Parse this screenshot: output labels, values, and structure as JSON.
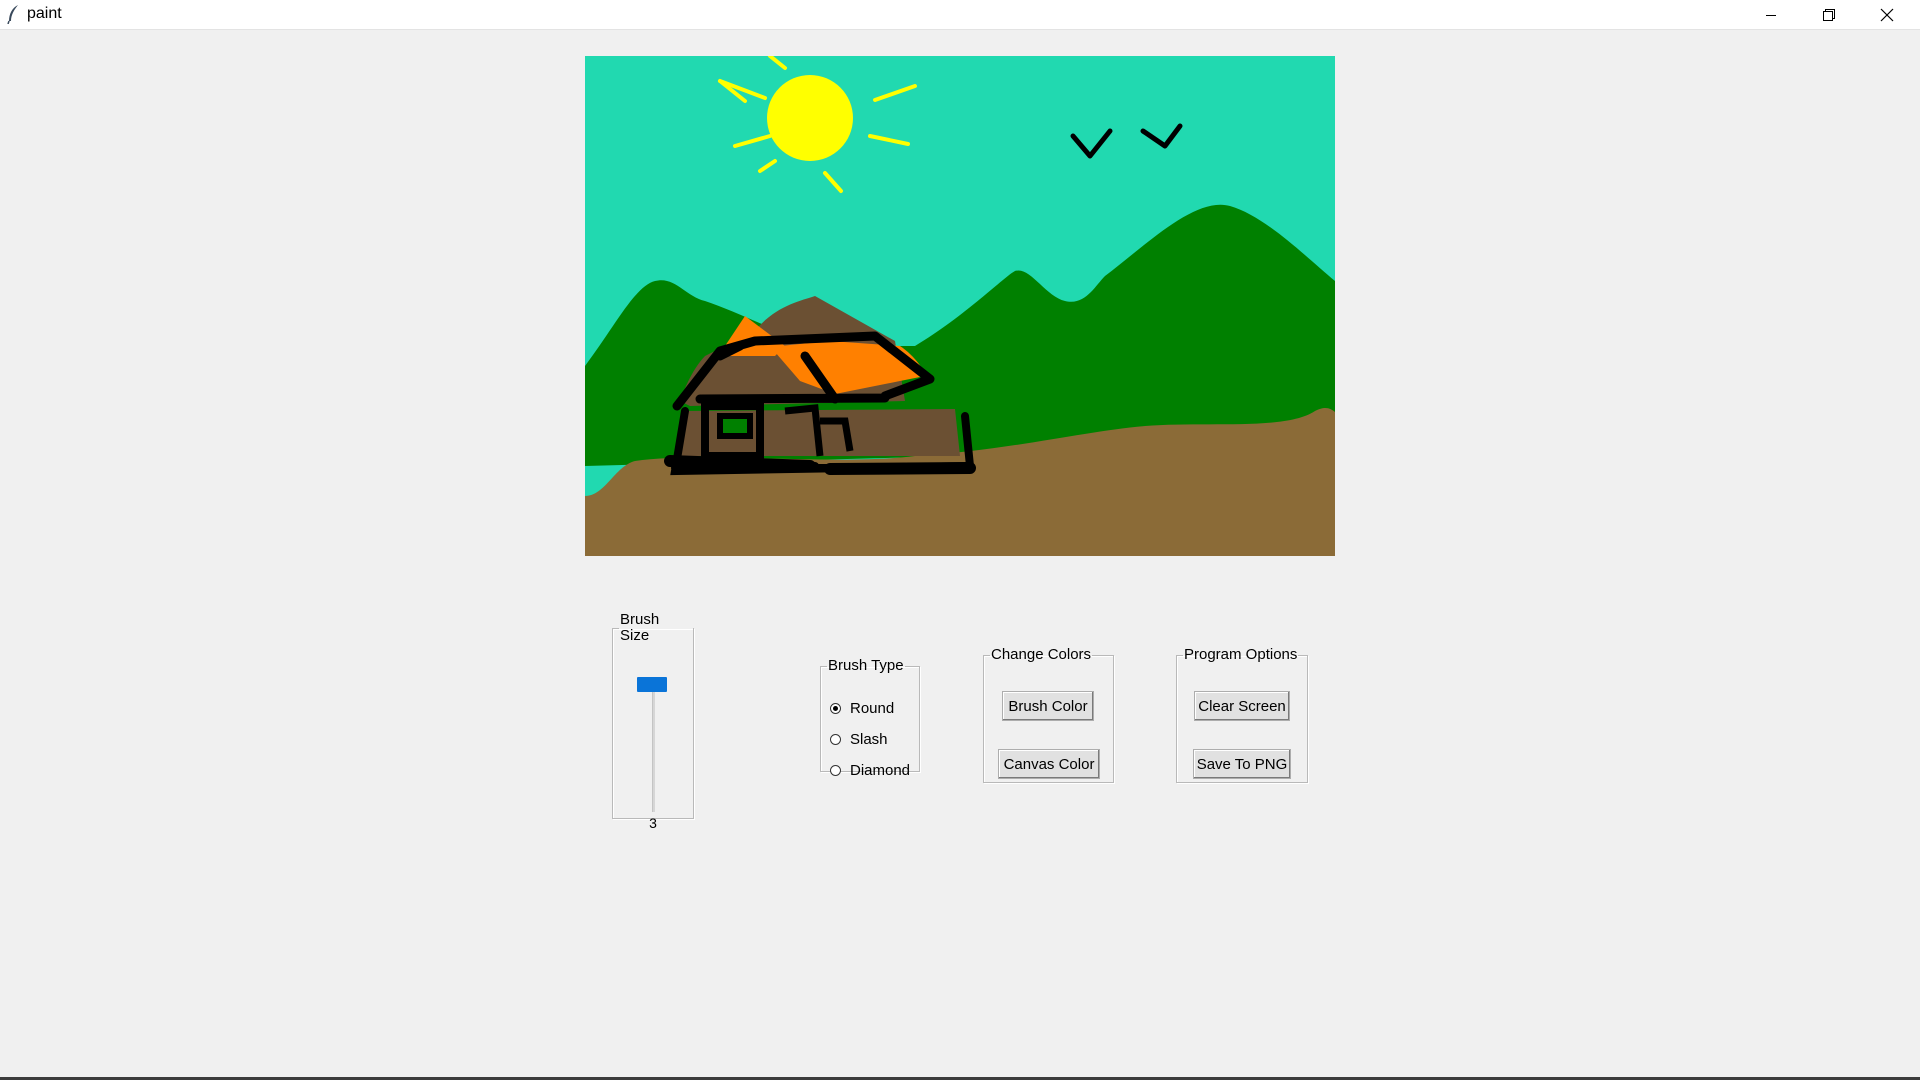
{
  "window": {
    "title": "paint",
    "icon": "feather-icon",
    "controls": [
      "minimize-icon",
      "restore-icon",
      "close-icon"
    ]
  },
  "canvas": {
    "background_color": "#21d9b0",
    "drawing": [
      "sun",
      "two birds",
      "green mountains",
      "brown ground",
      "house with orange roof"
    ]
  },
  "brush_size": {
    "legend": "Brush Size",
    "value": "3",
    "slider_color": "#0a74d8"
  },
  "brush_type": {
    "legend": "Brush Type",
    "options": [
      {
        "label": "Round",
        "checked": true
      },
      {
        "label": "Slash",
        "checked": false
      },
      {
        "label": "Diamond",
        "checked": false
      }
    ]
  },
  "change_colors": {
    "legend": "Change Colors",
    "brush_color_label": "Brush Color",
    "canvas_color_label": "Canvas Color"
  },
  "program_options": {
    "legend": "Program Options",
    "clear_screen_label": "Clear Screen",
    "save_png_label": "Save To PNG"
  }
}
